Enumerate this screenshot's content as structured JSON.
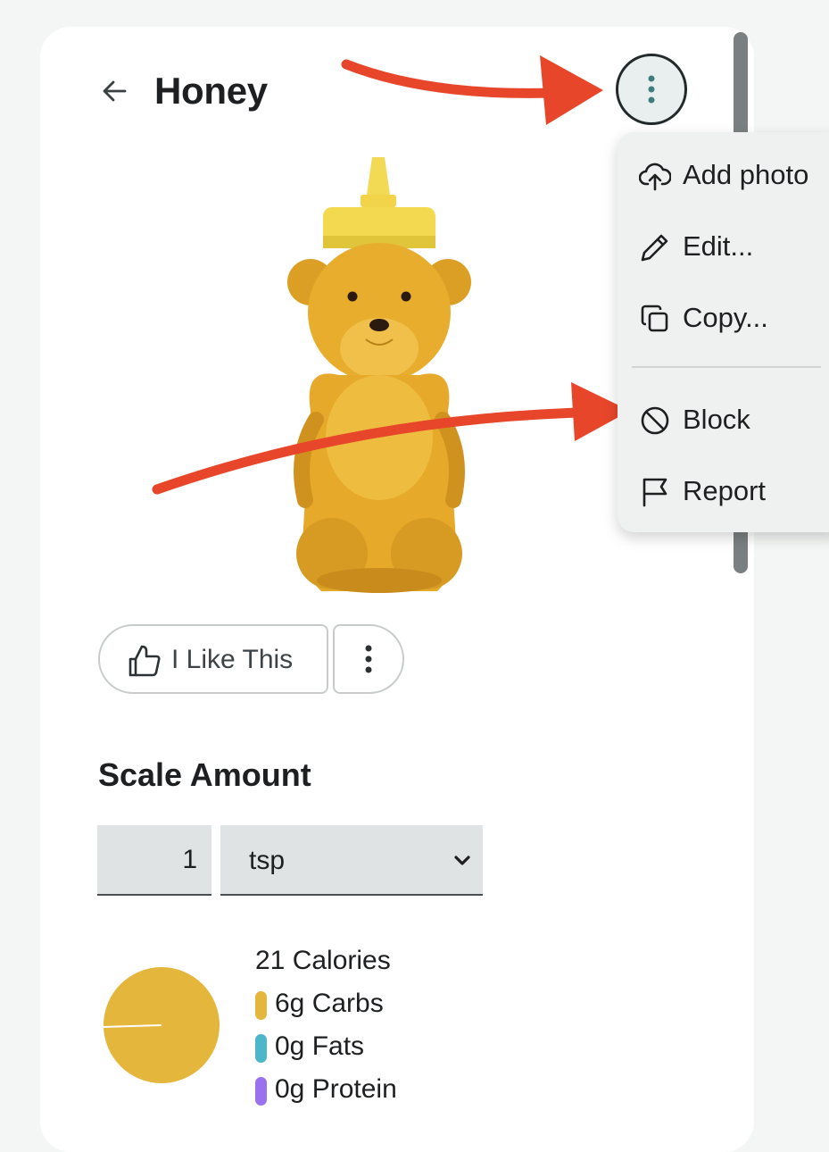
{
  "header": {
    "title": "Honey"
  },
  "menu": {
    "items": [
      {
        "label": "Add photo",
        "icon": "upload-cloud-icon"
      },
      {
        "label": "Edit...",
        "icon": "pencil-icon"
      },
      {
        "label": "Copy...",
        "icon": "copy-icon"
      },
      {
        "label": "Block",
        "icon": "block-icon"
      },
      {
        "label": "Report",
        "icon": "flag-icon"
      }
    ]
  },
  "actions": {
    "like_label": "I Like This"
  },
  "scale": {
    "title": "Scale Amount",
    "quantity": "1",
    "unit": "tsp"
  },
  "nutrition": {
    "calories": "21 Calories",
    "macros": [
      {
        "label": "6g Carbs",
        "color": "#e5b63c"
      },
      {
        "label": "0g Fats",
        "color": "#4db6c8"
      },
      {
        "label": "0g Protein",
        "color": "#9a72ee"
      }
    ]
  },
  "colors": {
    "annotation_arrow": "#e8462b",
    "pie_fill": "#e5b63c"
  }
}
